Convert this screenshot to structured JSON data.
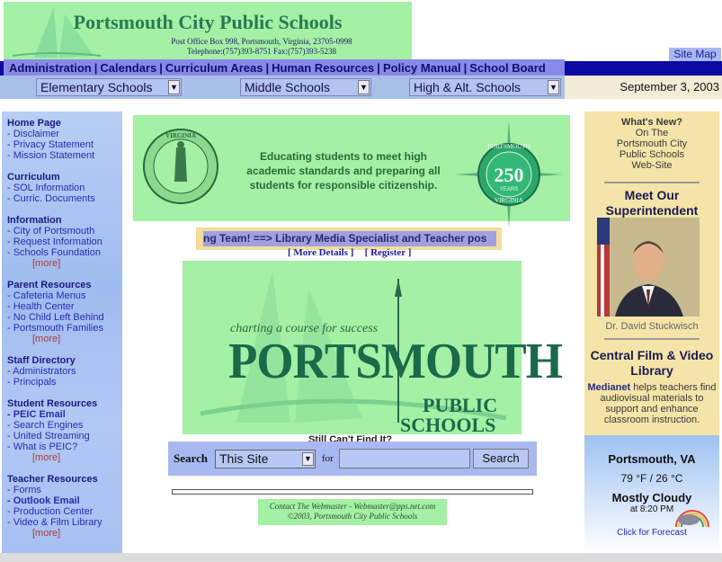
{
  "header": {
    "title": "Portsmouth City Public Schools",
    "address_line1": "Post Office Box 998, Portsmouth, Virginia, 23705-0998",
    "address_line2": "Telephone:(757)393-8751     Fax:(757)393-5238",
    "site_map": "Site Map"
  },
  "nav": {
    "items": [
      "Administration",
      "Calendars",
      "Curriculum Areas",
      "Human Resources",
      "Policy Manual",
      "School Board"
    ]
  },
  "selectors": {
    "elementary": "Elementary Schools",
    "middle": "Middle Schools",
    "high": "High & Alt. Schools"
  },
  "date": "September 3, 2003",
  "sidebar": {
    "sections": [
      {
        "heading": "Home Page",
        "links": [
          "- Disclaimer",
          "- Privacy Statement",
          "- Mission Statement"
        ]
      },
      {
        "heading": "Curriculum",
        "links": [
          "- SOL Information",
          "- Curric. Documents"
        ]
      },
      {
        "heading": "Information",
        "links": [
          "- City of Portsmouth",
          "- Request Information",
          "- Schools Foundation"
        ],
        "more": "[more]"
      },
      {
        "heading": "Parent Resources",
        "links": [
          "- Cafeteria Menus",
          "- Health Center",
          "- No Child Left Behind",
          "- Portsmouth Families"
        ],
        "more": "[more]"
      },
      {
        "heading": "Staff Directory",
        "links": [
          "- Administrators",
          "- Principals"
        ]
      },
      {
        "heading": "Student Resources",
        "links": [
          "- PEIC Email",
          "- Search Engines",
          "- United Streaming",
          "- What is PEIC?"
        ],
        "more": "[more]"
      },
      {
        "heading": "Teacher Resources",
        "links": [
          "- Forms",
          "- Outlook Email",
          "- Production Center",
          "- Video & Film Library"
        ],
        "more": "[more]"
      }
    ]
  },
  "banner": {
    "text": "Educating students to meet high academic standards and preparing all students for responsible citizenship.",
    "seal_left_text": "VIRGINIA",
    "seal_right_top": "PORTSMOUTH",
    "seal_right_num": "250",
    "seal_right_years": "YEARS",
    "seal_right_bottom": "VIRGINIA"
  },
  "marquee": {
    "text": "ng Team!  ==>  Library Media Specialist and Teacher pos"
  },
  "links": {
    "more_details": "[ More Details ]",
    "register": "[ Register ]"
  },
  "logo": {
    "tagline": "charting a course for success",
    "name": "PORTSMOUTH",
    "line2": "PUBLIC",
    "line3": "SCHOOLS"
  },
  "search": {
    "prompt": "Still Can't Find It?",
    "label": "Search",
    "scope": "This Site",
    "for_label": "for",
    "button": "Search",
    "value": ""
  },
  "footer": {
    "line1": "Contact The Webmaster - Webmaster@pps.net.com",
    "line2": "©2003, Portsmouth City Public Schools"
  },
  "right": {
    "whats_new": [
      "What's New?",
      "On The",
      "Portsmouth City",
      "Public Schools",
      "Web-Site"
    ],
    "meet_title": "Meet Our Superintendent",
    "supt_name": "Dr. David Stuckwisch",
    "film_title": "Central Film & Video Library",
    "film_brand": "Medianet",
    "film_desc": " helps teachers find audiovisual materials to support and enhance classroom instruction.",
    "weather_city": "Portsmouth, VA",
    "weather_temp": "79 °F / 26 °C",
    "weather_cond": "Mostly Cloudy",
    "weather_time": "at 8:20 PM",
    "weather_link": "Click for Forecast"
  },
  "colors": {
    "green_panel": "#a4f0a4",
    "nav_blue": "#0a0aa0",
    "title_green": "#2a7a55"
  }
}
